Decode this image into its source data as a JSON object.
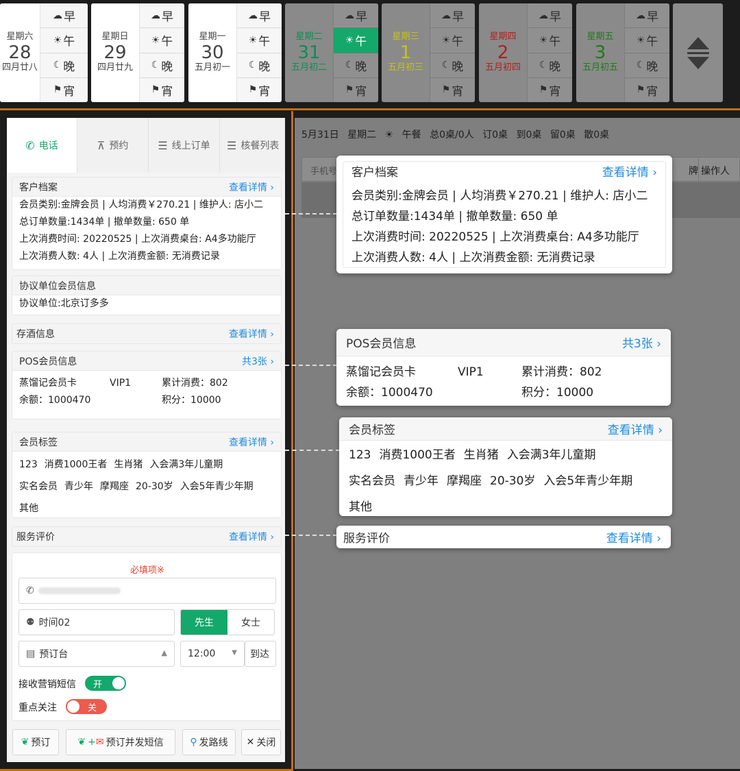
{
  "meal_labels": {
    "breakfast": "早",
    "lunch": "午",
    "dinner": "晚",
    "night": "宵"
  },
  "meal_icons": {
    "breakfast": "☁",
    "lunch": "☀",
    "dinner": "☾",
    "night": "⚑"
  },
  "days": [
    {
      "weekday": "星期六",
      "date": "28",
      "lunar": "四月廿八"
    },
    {
      "weekday": "星期日",
      "date": "29",
      "lunar": "四月廿九"
    },
    {
      "weekday": "星期一",
      "date": "30",
      "lunar": "五月初一"
    },
    {
      "weekday": "星期二",
      "date": "31",
      "lunar": "五月初二",
      "color": "#0f8c55"
    },
    {
      "weekday": "星期三",
      "date": "1",
      "lunar": "五月初三",
      "color": "#c7c21a"
    },
    {
      "weekday": "星期四",
      "date": "2",
      "lunar": "五月初四",
      "color": "#b0201e"
    },
    {
      "weekday": "星期五",
      "date": "3",
      "lunar": "五月初五",
      "color": "#1f7a18"
    }
  ],
  "tabs": {
    "phone": "电话",
    "reserve": "预约",
    "online": "线上订单",
    "verify": "核餐列表",
    "icons": {
      "phone": "phone-icon",
      "reserve": "table-icon",
      "online": "list-icon",
      "verify": "list-icon"
    }
  },
  "info_bar": {
    "date": "5月31日",
    "weekday": "星期二",
    "meal": "午餐",
    "total": "总0桌/0人",
    "ordered": "订0桌",
    "arrived": "到0桌",
    "kept": "留0桌",
    "walkin": "散0桌"
  },
  "search": {
    "placeholder": "手机号",
    "col_card": "牌",
    "col_operator": "操作人"
  },
  "customer": {
    "title": "客户档案",
    "link": "查看详情",
    "line1": "会员类别:金牌会员 | 人均消费￥270.21 | 维护人: 店小二",
    "line2": "总订单数量:1434单 | 撤单数量: 650 单",
    "line3": "上次消费时间: 20220525 | 上次消费桌台: A4多功能厅",
    "line4": "上次消费人数: 4人 | 上次消费金额: 无消费记录"
  },
  "agreement": {
    "title": "协议单位会员信息",
    "value": "协议单位:北京订多多"
  },
  "wine": {
    "title": "存酒信息",
    "link": "查看详情"
  },
  "pos": {
    "title": "POS会员信息",
    "link": "共3张",
    "card_name": "蒸馏记会员卡",
    "level": "VIP1",
    "spend": "累计消费：802",
    "balance": "余额：1000470",
    "points": "积分：10000"
  },
  "tags": {
    "title": "会员标签",
    "link": "查看详情",
    "row1": [
      "123",
      "消费1000王者",
      "生肖猪",
      "入会满3年儿童期"
    ],
    "row2": [
      "实名会员",
      "青少年",
      "摩羯座",
      "20-30岁",
      "入会5年青少年期"
    ],
    "row3": [
      "其他"
    ]
  },
  "service": {
    "title": "服务评价",
    "link": "查看详情"
  },
  "form": {
    "required": "必填项※",
    "name": "时间02",
    "mr": "先生",
    "ms": "女士",
    "table": "预订台",
    "time": "12:00",
    "arrive": "到达",
    "sms_label": "接收营销短信",
    "sms_on": "开",
    "focus_label": "重点关注",
    "focus_off": "关"
  },
  "buttons": {
    "reserve": "预订",
    "reserve_sms": "预订并发短信",
    "route": "发路线",
    "close": "关闭"
  },
  "colors": {
    "accent": "#14a86b",
    "link": "#1f8ce0",
    "required": "#e8402e",
    "frame": "#c37012"
  }
}
